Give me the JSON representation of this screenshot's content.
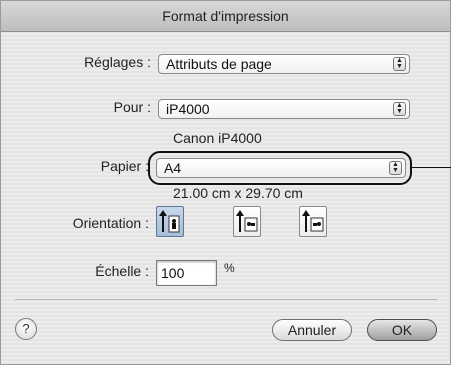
{
  "window": {
    "title": "Format d'impression"
  },
  "settings": {
    "label": "Réglages :",
    "value": "Attributs de page"
  },
  "format_for": {
    "label": "Pour :",
    "value": "iP4000",
    "description": "Canon iP4000"
  },
  "paper": {
    "label": "Papier :",
    "value": "A4",
    "dimensions": "21.00 cm x 29.70 cm"
  },
  "orientation": {
    "label": "Orientation :",
    "options": [
      "portrait",
      "landscape-left",
      "landscape-right"
    ],
    "selected": "portrait"
  },
  "scale": {
    "label": "Échelle :",
    "value": "100",
    "unit": "%"
  },
  "buttons": {
    "help": "?",
    "cancel": "Annuler",
    "ok": "OK"
  },
  "icons": {
    "popup": "up-down-arrows-icon",
    "orientation_portrait": "portrait-orientation-icon",
    "orientation_landscape_left": "landscape-left-orientation-icon",
    "orientation_landscape_right": "landscape-right-orientation-icon"
  }
}
